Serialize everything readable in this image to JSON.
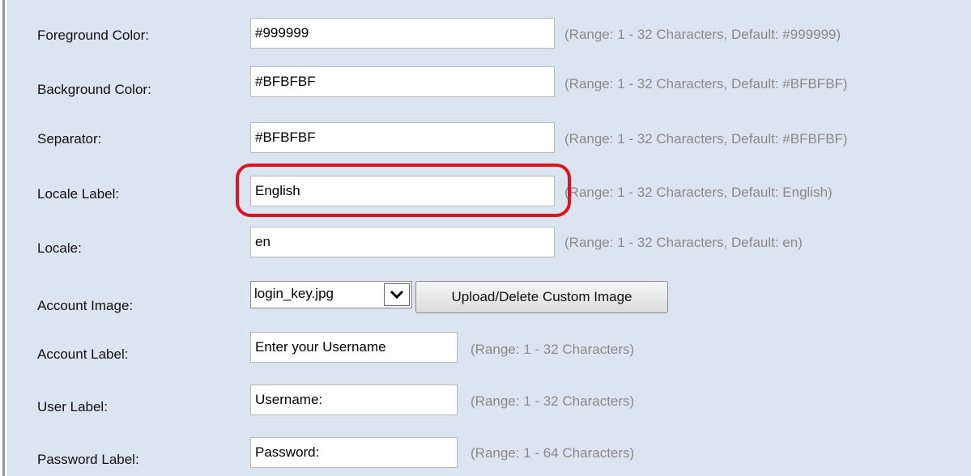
{
  "form": {
    "foreground_color": {
      "label": "Foreground Color:",
      "value": "#999999",
      "hint": "(Range: 1 - 32 Characters, Default: #999999)"
    },
    "background_color": {
      "label": "Background Color:",
      "value": "#BFBFBF",
      "hint": "(Range: 1 - 32 Characters, Default: #BFBFBF)"
    },
    "separator": {
      "label": "Separator:",
      "value": "#BFBFBF",
      "hint": "(Range: 1 - 32 Characters, Default: #BFBFBF)"
    },
    "locale_label": {
      "label": "Locale Label:",
      "value": "English",
      "hint": "(Range: 1 - 32 Characters, Default: English)"
    },
    "locale": {
      "label": "Locale:",
      "value": "en",
      "hint": "(Range: 1 - 32 Characters, Default: en)"
    },
    "account_image": {
      "label": "Account Image:",
      "selected": "login_key.jpg",
      "button_label": "Upload/Delete Custom Image"
    },
    "account_label": {
      "label": "Account Label:",
      "value": "Enter your Username",
      "hint": "(Range: 1 - 32 Characters)"
    },
    "user_label": {
      "label": "User Label:",
      "value": "Username:",
      "hint": "(Range: 1 - 32 Characters)"
    },
    "password_label": {
      "label": "Password Label:",
      "value": "Password:",
      "hint": "(Range: 1 - 64 Characters)"
    }
  },
  "annotation": {
    "highlight_color": "#e3111b"
  },
  "colors": {
    "panel_background": "#dbe5f1",
    "hint_text": "#8a8a8a"
  },
  "icons": {
    "dropdown": "chevron-down-icon"
  }
}
